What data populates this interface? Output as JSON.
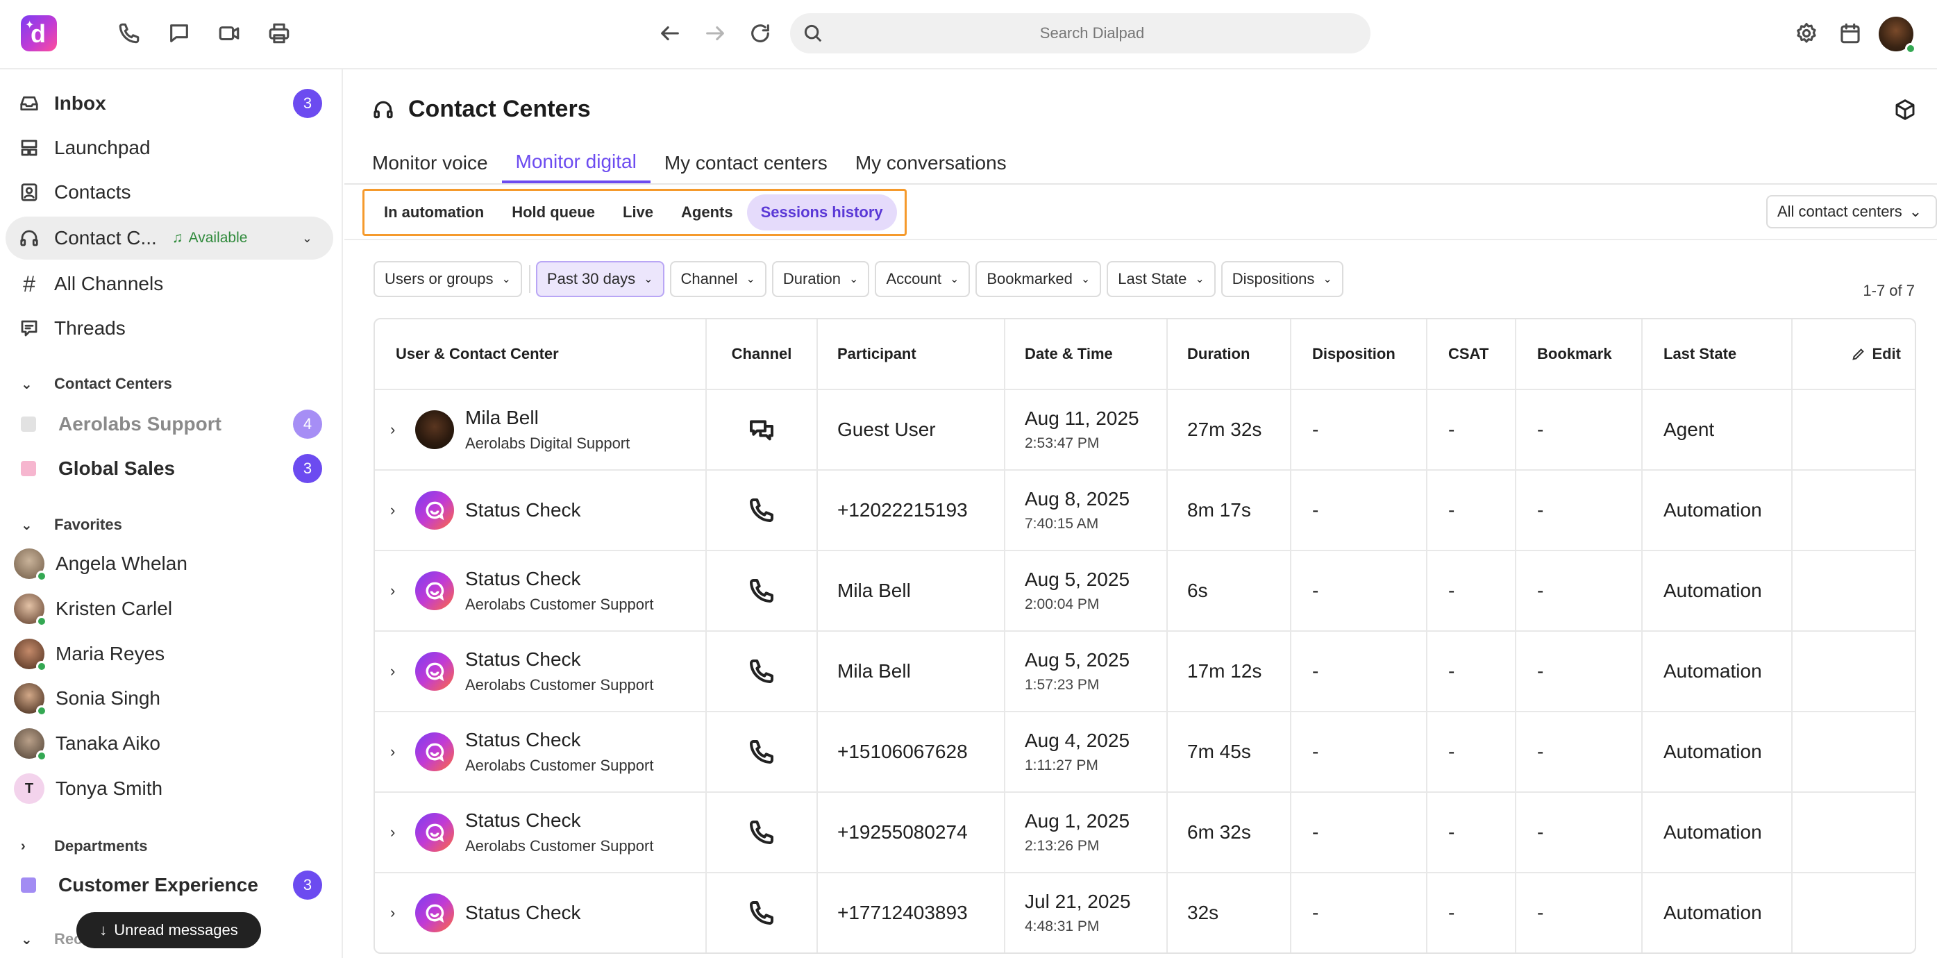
{
  "topbar": {
    "search_placeholder": "Search Dialpad",
    "logo_letter": "d"
  },
  "sidebar": {
    "items": [
      {
        "label": "Inbox",
        "badge": "3"
      },
      {
        "label": "Launchpad"
      },
      {
        "label": "Contacts"
      },
      {
        "label": "Contact C...",
        "status": "Available"
      },
      {
        "label": "All Channels"
      },
      {
        "label": "Threads"
      }
    ],
    "contact_centers_heading": "Contact Centers",
    "contact_centers": [
      {
        "label": "Aerolabs Support",
        "badge": "4",
        "color": "#e2e2e2"
      },
      {
        "label": "Global Sales",
        "badge": "3",
        "color": "#f6b6cf"
      }
    ],
    "favorites_heading": "Favorites",
    "favorites": [
      {
        "name": "Angela Whelan"
      },
      {
        "name": "Kristen Carlel"
      },
      {
        "name": "Maria Reyes"
      },
      {
        "name": "Sonia Singh"
      },
      {
        "name": "Tanaka Aiko"
      },
      {
        "name": "Tonya Smith",
        "initial": "T"
      }
    ],
    "departments_heading": "Departments",
    "departments": [
      {
        "label": "Customer Experience",
        "badge": "3",
        "color": "#a28cf3"
      }
    ],
    "recents_heading": "Recents",
    "toast": "Unread messages"
  },
  "main": {
    "title": "Contact Centers",
    "tabs": [
      "Monitor voice",
      "Monitor digital",
      "My contact centers",
      "My conversations"
    ],
    "subtabs": [
      "In automation",
      "Hold queue",
      "Live",
      "Agents",
      "Sessions history"
    ],
    "all_centers": "All contact centers",
    "filters": [
      "Users or groups",
      "Past 30 days",
      "Channel",
      "Duration",
      "Account",
      "Bookmarked",
      "Last State",
      "Dispositions"
    ],
    "count": "1-7 of 7",
    "table": {
      "headers": [
        "User & Contact Center",
        "Channel",
        "Participant",
        "Date & Time",
        "Duration",
        "Disposition",
        "CSAT",
        "Bookmark",
        "Last State",
        "Edit"
      ],
      "rows": [
        {
          "name": "Mila Bell",
          "sub": "Aerolabs Digital Support",
          "channel": "chat-icon",
          "participant": "Guest User",
          "date": "Aug 11, 2025",
          "time": "2:53:47 PM",
          "duration": "27m 32s",
          "disposition": "-",
          "csat": "-",
          "bookmark": "-",
          "last_state": "Agent"
        },
        {
          "name": "Status Check",
          "sub": "",
          "channel": "phone-icon",
          "participant": "+12022215193",
          "date": "Aug 8, 2025",
          "time": "7:40:15 AM",
          "duration": "8m 17s",
          "disposition": "-",
          "csat": "-",
          "bookmark": "-",
          "last_state": "Automation"
        },
        {
          "name": "Status Check",
          "sub": "Aerolabs Customer Support",
          "channel": "phone-icon",
          "participant": "Mila Bell",
          "date": "Aug 5, 2025",
          "time": "2:00:04 PM",
          "duration": "6s",
          "disposition": "-",
          "csat": "-",
          "bookmark": "-",
          "last_state": "Automation"
        },
        {
          "name": "Status Check",
          "sub": "Aerolabs Customer Support",
          "channel": "phone-icon",
          "participant": "Mila Bell",
          "date": "Aug 5, 2025",
          "time": "1:57:23 PM",
          "duration": "17m 12s",
          "disposition": "-",
          "csat": "-",
          "bookmark": "-",
          "last_state": "Automation"
        },
        {
          "name": "Status Check",
          "sub": "Aerolabs Customer Support",
          "channel": "phone-icon",
          "participant": "+15106067628",
          "date": "Aug 4, 2025",
          "time": "1:11:27 PM",
          "duration": "7m 45s",
          "disposition": "-",
          "csat": "-",
          "bookmark": "-",
          "last_state": "Automation"
        },
        {
          "name": "Status Check",
          "sub": "Aerolabs Customer Support",
          "channel": "phone-icon",
          "participant": "+19255080274",
          "date": "Aug 1, 2025",
          "time": "2:13:26 PM",
          "duration": "6m 32s",
          "disposition": "-",
          "csat": "-",
          "bookmark": "-",
          "last_state": "Automation"
        },
        {
          "name": "Status Check",
          "sub": "",
          "channel": "phone-icon",
          "participant": "+17712403893",
          "date": "Jul 21, 2025",
          "time": "4:48:31 PM",
          "duration": "32s",
          "disposition": "-",
          "csat": "-",
          "bookmark": "-",
          "last_state": "Automation"
        }
      ]
    }
  },
  "colors": {
    "accent": "#6c4bf0",
    "highlight_border": "#f59a2c",
    "available": "#2f8a3b"
  }
}
